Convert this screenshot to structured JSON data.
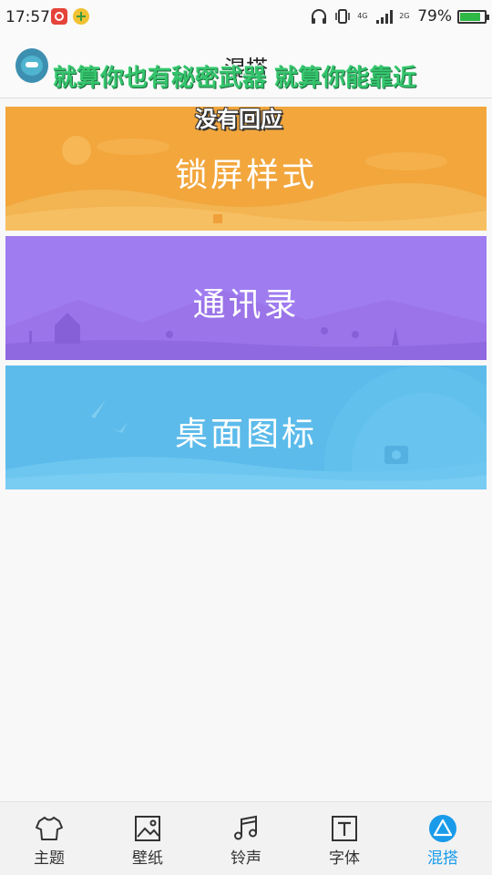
{
  "status_bar": {
    "time": "17:57",
    "battery_percent": "79%",
    "battery_level": 0.79,
    "network_top": "4G",
    "network_bottom": "2G",
    "icons": [
      "netease-music-icon",
      "plus-app-icon",
      "headphones-icon",
      "vibrate-icon",
      "signal-icon",
      "battery-icon"
    ]
  },
  "header": {
    "title": "混搭",
    "overlay_text_1": "就算你也有秘密武器 就算你能靠近",
    "overlay_text_2": "没有回应"
  },
  "cards": [
    {
      "label": "锁屏样式",
      "color": "#f2a63c"
    },
    {
      "label": "通讯录",
      "color": "#9f7cf0"
    },
    {
      "label": "桌面图标",
      "color": "#5cbbea"
    }
  ],
  "bottom_nav": {
    "active_color": "#1a9bea",
    "items": [
      {
        "label": "主题",
        "icon": "tshirt-icon"
      },
      {
        "label": "壁纸",
        "icon": "image-icon"
      },
      {
        "label": "铃声",
        "icon": "music-note-icon"
      },
      {
        "label": "字体",
        "icon": "font-t-icon"
      },
      {
        "label": "混搭",
        "icon": "triangle-mix-icon"
      }
    ]
  }
}
